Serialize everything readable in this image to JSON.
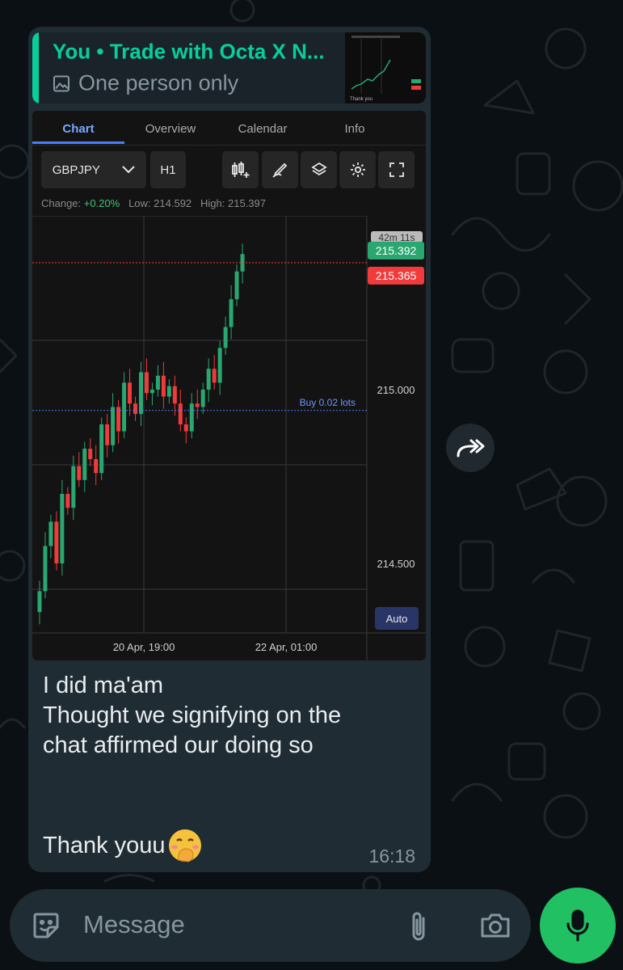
{
  "reply_quote": {
    "title": "You • Trade with Octa X N...",
    "subtitle": "One person only"
  },
  "trading_app": {
    "tabs": [
      "Chart",
      "Overview",
      "Calendar",
      "Info"
    ],
    "active_tab": "Chart",
    "symbol": "GBPJPY",
    "timeframe": "H1",
    "stats": {
      "change_label": "Change:",
      "change_value": "+0.20%",
      "low_label": "Low:",
      "low_value": "214.592",
      "high_label": "High:",
      "high_value": "215.397"
    },
    "auto_label": "Auto"
  },
  "chart_data": {
    "type": "candlestick",
    "title": "",
    "yticks": [
      "215.000",
      "214.500"
    ],
    "xticks": [
      "20 Apr, 19:00",
      "22 Apr, 01:00"
    ],
    "ylim": [
      214.3,
      215.5
    ],
    "countdown_label": "42m 11s",
    "bid_price": "215.392",
    "ask_price": "215.365",
    "order_line_label": "Buy 0.02 lots",
    "order_line_price": 214.94,
    "colors": {
      "up": "#2aa770",
      "down": "#ef3b3b",
      "grid": "#3a3a3a"
    }
  },
  "message": {
    "lines": [
      "I did ma'am",
      "Thought we signifying on the",
      "chat affirmed our doing so"
    ],
    "thanks": "Thank youu",
    "emoji": "face-with-hand-over-mouth",
    "time": "16:18"
  },
  "input": {
    "placeholder": "Message"
  },
  "icons": {
    "sticker": "sticker-icon",
    "attach": "paperclip-icon",
    "camera": "camera-icon",
    "mic": "microphone-icon",
    "forward": "forward-icon"
  },
  "colors": {
    "background": "#0b1014",
    "bubble": "#202c33",
    "accent": "#06cf9c",
    "mic_button": "#21c063"
  }
}
